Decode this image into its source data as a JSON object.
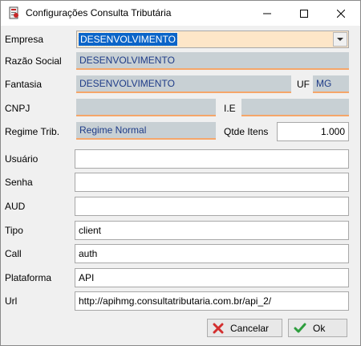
{
  "window": {
    "title": "Configurações Consulta Tributária"
  },
  "form": {
    "empresa": {
      "label": "Empresa",
      "value": "DESENVOLVIMENTO"
    },
    "razao_social": {
      "label": "Razão Social",
      "value": "DESENVOLVIMENTO"
    },
    "fantasia": {
      "label": "Fantasia",
      "value": "DESENVOLVIMENTO"
    },
    "uf": {
      "label": "UF",
      "value": "MG"
    },
    "cnpj": {
      "label": "CNPJ",
      "value": ""
    },
    "ie": {
      "label": "I.E",
      "value": ""
    },
    "regime": {
      "label": "Regime Trib.",
      "value": "Regime Normal"
    },
    "qtde_itens": {
      "label": "Qtde Itens",
      "value": "1.000"
    },
    "usuario": {
      "label": "Usuário",
      "value": ""
    },
    "senha": {
      "label": "Senha",
      "value": ""
    },
    "aud": {
      "label": "AUD",
      "value": ""
    },
    "tipo": {
      "label": "Tipo",
      "value": "client"
    },
    "call": {
      "label": "Call",
      "value": "auth"
    },
    "plataforma": {
      "label": "Plataforma",
      "value": "API"
    },
    "url": {
      "label": "Url",
      "value": "http://apihmg.consultatributaria.com.br/api_2/"
    }
  },
  "buttons": {
    "cancel_label": "Cancelar",
    "ok_label": "Ok"
  },
  "colors": {
    "readonly_bg": "#c8d0d4",
    "readonly_underline": "#f5a66a",
    "combo_bg": "#fde6c8",
    "selection": "#0a64c8",
    "cancel_icon": "#d32f2f",
    "ok_icon": "#2e9e3e"
  },
  "icons": {
    "app": "app-icon",
    "minimize": "minimize-icon",
    "maximize": "maximize-icon",
    "close": "close-icon",
    "dropdown": "chevron-down-icon",
    "cancel": "x-icon",
    "ok": "check-icon"
  }
}
